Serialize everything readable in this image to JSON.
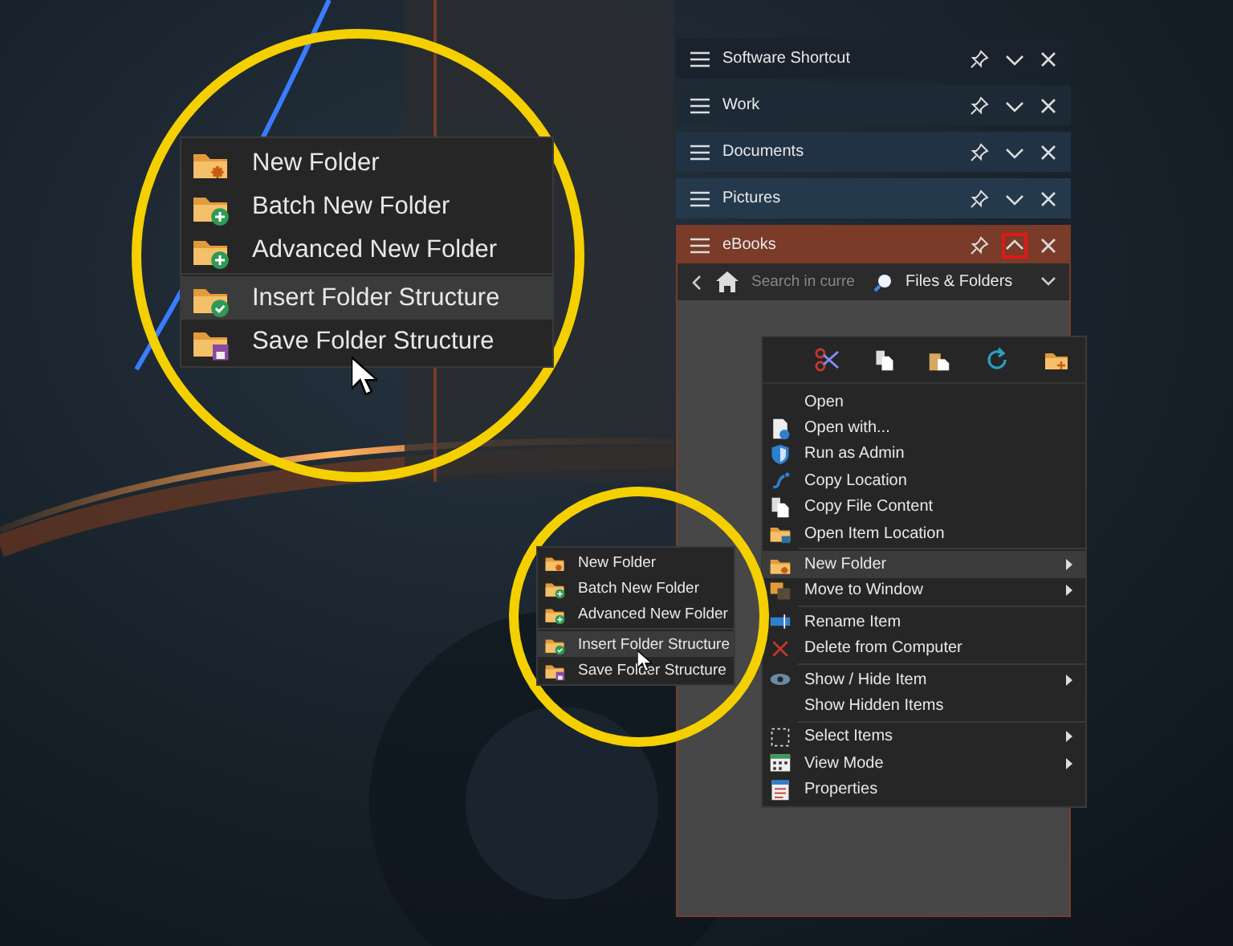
{
  "panels": [
    {
      "title": "Software Shortcut",
      "color": "#1a232d",
      "expanded": false,
      "highlighted": false
    },
    {
      "title": "Work",
      "color": "#1d2a36",
      "expanded": false,
      "highlighted": false
    },
    {
      "title": "Documents",
      "color": "#213245",
      "expanded": false,
      "highlighted": false
    },
    {
      "title": "Pictures",
      "color": "#24394c",
      "expanded": false,
      "highlighted": false
    },
    {
      "title": "eBooks",
      "color": "#7a3b29",
      "expanded": true,
      "highlighted": true
    }
  ],
  "browser_bar": {
    "placeholder": "Search in curre",
    "filter": "Files & Folders"
  },
  "context_menu": {
    "groups": [
      [
        {
          "label": "Open",
          "submenu": false,
          "selected": false
        },
        {
          "label": "Open with...",
          "submenu": false,
          "selected": false
        },
        {
          "label": "Run as Admin",
          "submenu": false,
          "selected": false
        },
        {
          "label": "Copy Location",
          "submenu": false,
          "selected": false
        },
        {
          "label": "Copy File Content",
          "submenu": false,
          "selected": false
        },
        {
          "label": "Open Item Location",
          "submenu": false,
          "selected": false
        }
      ],
      [
        {
          "label": "New Folder",
          "submenu": true,
          "selected": true
        },
        {
          "label": "Move to Window",
          "submenu": true,
          "selected": false
        }
      ],
      [
        {
          "label": "Rename Item",
          "submenu": false,
          "selected": false
        },
        {
          "label": "Delete from Computer",
          "submenu": false,
          "selected": false
        }
      ],
      [
        {
          "label": "Show / Hide Item",
          "submenu": true,
          "selected": false
        },
        {
          "label": "Show Hidden Items",
          "submenu": false,
          "selected": false
        }
      ],
      [
        {
          "label": "Select Items",
          "submenu": true,
          "selected": false
        },
        {
          "label": "View Mode",
          "submenu": true,
          "selected": false
        },
        {
          "label": "Properties",
          "submenu": false,
          "selected": false
        }
      ]
    ]
  },
  "submenu": {
    "groups": [
      [
        {
          "label": "New Folder",
          "selected": false
        },
        {
          "label": "Batch New Folder",
          "selected": false
        },
        {
          "label": "Advanced New Folder",
          "selected": false
        }
      ],
      [
        {
          "label": "Insert Folder Structure",
          "selected": true
        },
        {
          "label": "Save Folder Structure",
          "selected": false
        }
      ]
    ]
  },
  "magnified_submenu": {
    "groups": [
      [
        {
          "label": "New Folder",
          "selected": false
        },
        {
          "label": "Batch New Folder",
          "selected": false
        },
        {
          "label": "Advanced New Folder",
          "selected": false
        }
      ],
      [
        {
          "label": "Insert Folder Structure",
          "selected": true
        },
        {
          "label": "Save Folder Structure",
          "selected": false
        }
      ]
    ]
  }
}
